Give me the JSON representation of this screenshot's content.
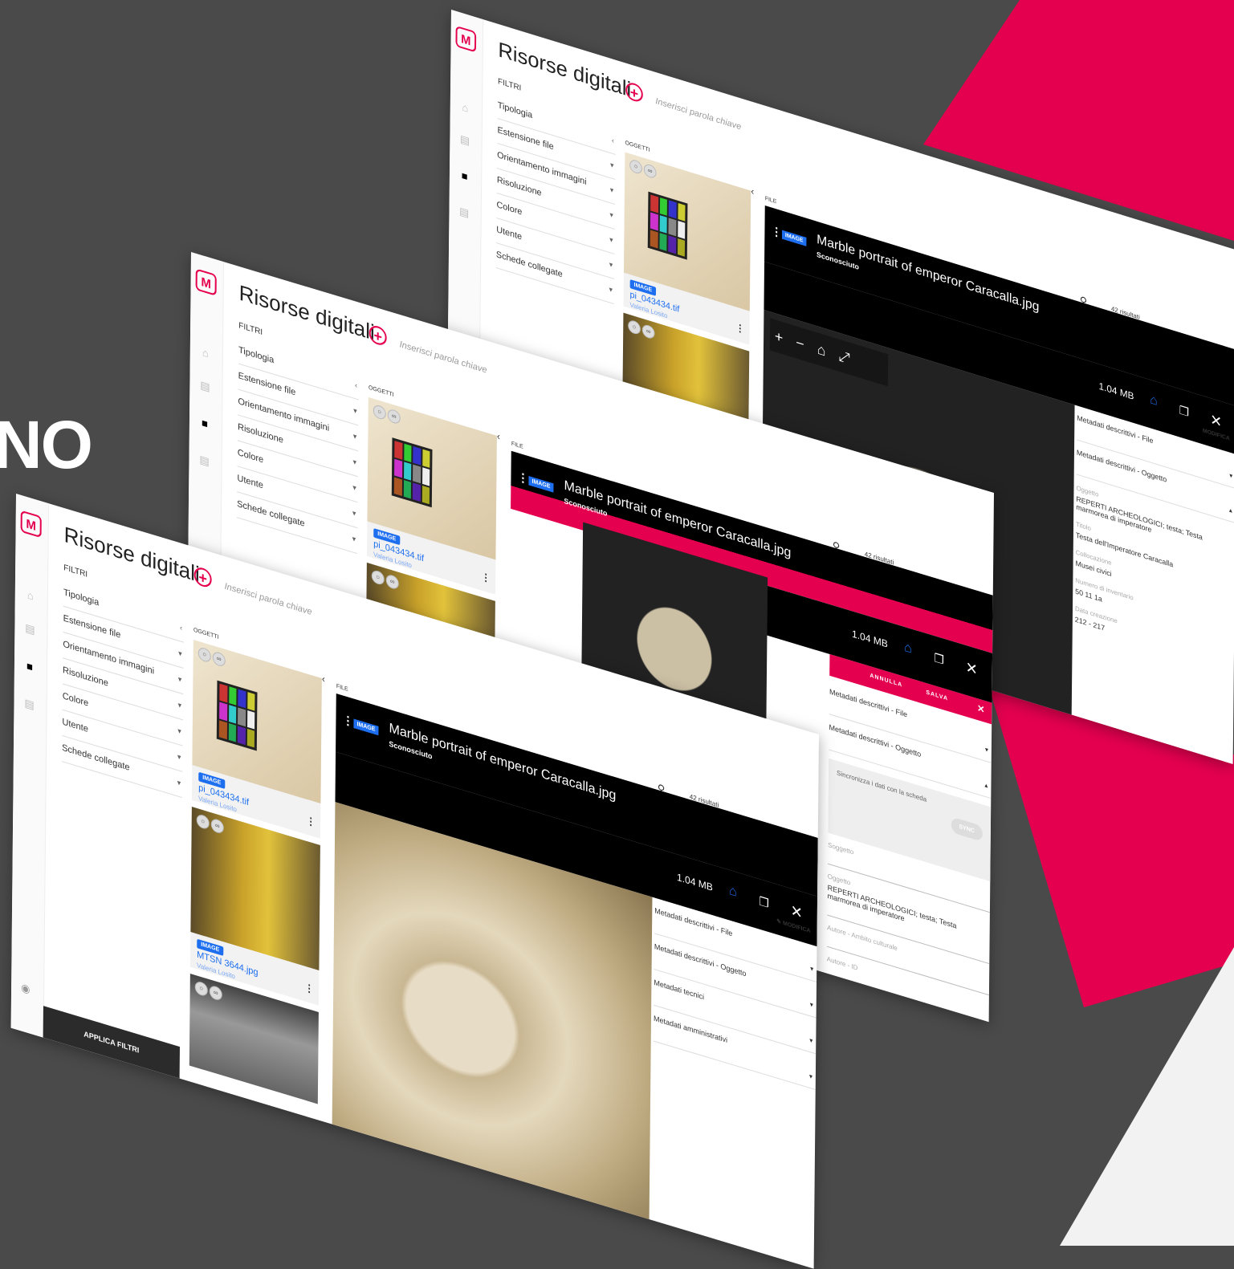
{
  "headline": "NO",
  "colors": {
    "accent": "#e4004f",
    "link": "#1e6ff0",
    "background": "#4a4a4a"
  },
  "app": {
    "title": "Risorse digitali",
    "search_placeholder": "Inserisci parola chiave",
    "filters_title": "FILTRI",
    "filters": [
      "Tipologia",
      "Estensione file",
      "Orientamento immagini",
      "Risoluzione",
      "Colore",
      "Utente",
      "Schede collegate"
    ],
    "apply_label": "APPLICA FILTRI",
    "objects_label": "OGGETTI",
    "file_label": "FILE",
    "results": "42 risultati"
  },
  "cards": [
    {
      "type": "IMAGE",
      "name": "pi_043434.tif",
      "user": "Valeria Losito"
    },
    {
      "type": "IMAGE",
      "name": "MTSN 3644.jpg",
      "user": "Valeria Losito"
    }
  ],
  "detail": {
    "type": "IMAGE",
    "filename": "Marble portrait of emperor Caracalla.jpg",
    "author": "Sconosciuto",
    "size": "1.04 MB",
    "edit_label": "MODIFICA",
    "cancel_label": "ANNULLA",
    "save_label": "SALVA",
    "sections": [
      "Metadati descrittivi - File",
      "Metadati descrittivi - Oggetto",
      "Metadati tecnici",
      "Metadati amministrativi"
    ],
    "sync_text": "Sincronizza i dati con la scheda",
    "sync_button": "SYNC",
    "fields": {
      "soggetto_label": "Soggetto",
      "oggetto_label": "Oggetto",
      "oggetto_value": "REPERTI ARCHEOLOGICI; testa; Testa marmorea di imperatore",
      "oggetto_value_alt": "REPERTI ARCHEOLOGICI; testa; Testa marmorea di imperatore",
      "autore_ambito_label": "Autore - Ambito culturale",
      "autore_id_label": "Autore - ID",
      "titolo_label": "Titolo",
      "titolo_value": "Testa dell'Imperatore Caracalla",
      "collocazione_label": "Collocazione",
      "collocazione_value": "Musei civici",
      "inventario_label": "Numero di inventario",
      "inventario_value": "50 11 1a",
      "data_label": "Data creazione",
      "data_value": "212 - 217"
    }
  }
}
